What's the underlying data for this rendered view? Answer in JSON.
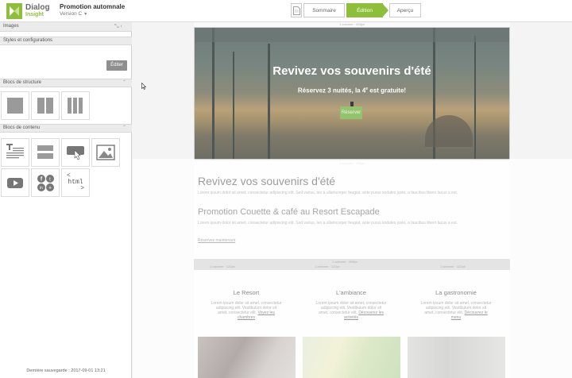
{
  "app": {
    "logo_line1": "Dialog",
    "logo_line2": "Insight",
    "project_name": "Promotion automnale",
    "version_label": "Version C"
  },
  "steps": {
    "summary": "Sommaire",
    "edit": "Édition",
    "preview": "Aperçu",
    "active": "Édition"
  },
  "panel": {
    "title": "Images",
    "sections": {
      "styles": "Styles et configurations",
      "structure": "Blocs de structure",
      "content": "Blocs de contenu"
    },
    "edit_button": "Éditer",
    "html_block_line1": "<",
    "html_block_line2": "html",
    "html_block_line3": ">",
    "last_saved": "Dernière sauvegarde : 2017-09-01 13:21"
  },
  "canvas": {
    "ruler_top": "1 colonne · 398px",
    "ruler_bottom": "1 colonne · 398px",
    "hero": {
      "title": "Revivez vos souvenirs d'été",
      "subtitle_pre": "Réservez 3 nuités, la 4",
      "subtitle_sup": "e",
      "subtitle_post": " est gratuite!",
      "button": "Réserver"
    },
    "section1_title": "Revivez vos souvenirs d'été",
    "section1_text": "Lorem ipsum dolor sit amet, consectetur adipiscing elit. Sed varius, leo a ullamcorper feugiat, ante purus sodales justo, a faucibus libero lacus a est.",
    "section2_title": "Promotion Couette & café au Resort Escapade",
    "section2_text": "Lorem ipsum dolor sit amet, consectetur adipiscing elit. Sed varius, leo a ullamcorper feugiat, ante purus sodales justo, a faucibus libero lacus a est.",
    "section2_link": "Réservez maintenant",
    "cols_bar_center": "1 colonne · 398px",
    "cols_bar_col1": "1 colonne · 122px",
    "cols_bar_col2": "1 colonne · 122px",
    "cols_bar_col3": "1 colonne · 122px",
    "columns": [
      {
        "title": "Le Resort",
        "text": "Lorem ipsum dolor sit amet, consectetur adipiscing elit. Vestibulum dolor sit amet, consectetur elit.",
        "link": "Voyez les chambres"
      },
      {
        "title": "L'ambiance",
        "text": "Lorem ipsum dolor sit amet, consectetur adipiscing elit. Vestibulum dolor sit amet, consectetur elit.",
        "link": "Découvrez les activités"
      },
      {
        "title": "La gastronomie",
        "text": "Lorem ipsum dolor sit amet, consectetur adipiscing elit. Vestibulum dolor sit amet, consectetur elit.",
        "link": "Découvrez le menu"
      }
    ]
  },
  "colors": {
    "accent": "#8dbf3a",
    "panel_header": "#ebebeb",
    "canvas_bg": "#f4f4f4"
  },
  "icons": [
    "expand-icon",
    "collapse-icon",
    "document-icon",
    "text-block-icon",
    "divider-block-icon",
    "button-block-icon",
    "image-block-icon",
    "video-block-icon",
    "social-block-icon",
    "html-block-icon"
  ]
}
